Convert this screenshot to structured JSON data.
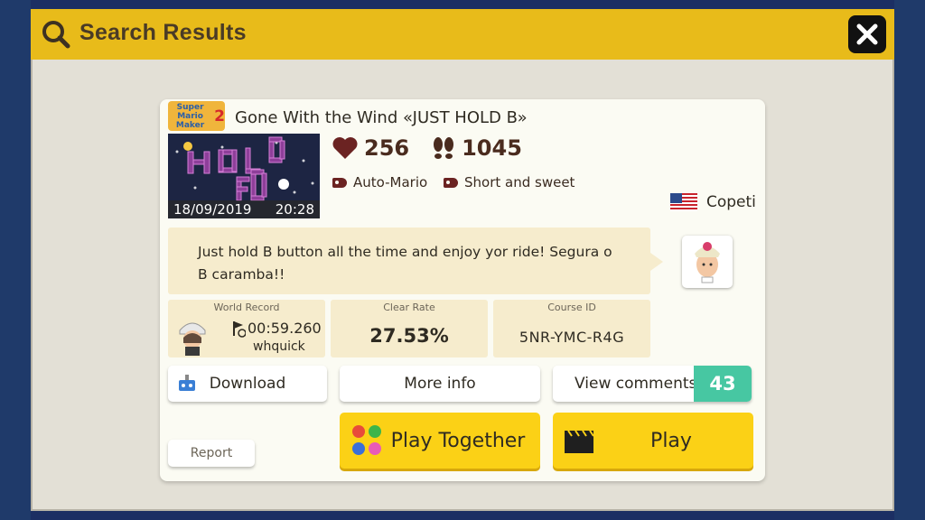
{
  "header": {
    "title": "Search Results",
    "search_icon": "search-icon",
    "close_icon": "close-icon"
  },
  "course": {
    "game_badge_text": "Super Mario Maker",
    "game_badge_number": "2",
    "title": "Gone With the Wind «JUST HOLD B»",
    "upload_date": "18/09/2019",
    "upload_time": "20:28",
    "likes": "256",
    "plays": "1045",
    "tags": [
      "Auto-Mario",
      "Short and sweet"
    ],
    "maker_name": "Copeti",
    "description": "Just hold B button all the time and enjoy yor ride!   Segura o B caramba!!"
  },
  "world_record": {
    "label": "World Record",
    "time": "00:59.260",
    "holder": "whquick"
  },
  "clear_rate": {
    "label": "Clear Rate",
    "value": "27.53%"
  },
  "course_id": {
    "label": "Course ID",
    "value": "5NR-YMC-R4G"
  },
  "buttons": {
    "download": "Download",
    "more_info": "More info",
    "view_comments": "View comments",
    "comment_count": "43",
    "report": "Report",
    "play_together": "Play Together",
    "play": "Play"
  },
  "colors": {
    "title_bar": "#e8bb1a",
    "primary_button": "#fbd116",
    "comment_count_bg": "#47c7a2",
    "heart": "#6b2322"
  }
}
